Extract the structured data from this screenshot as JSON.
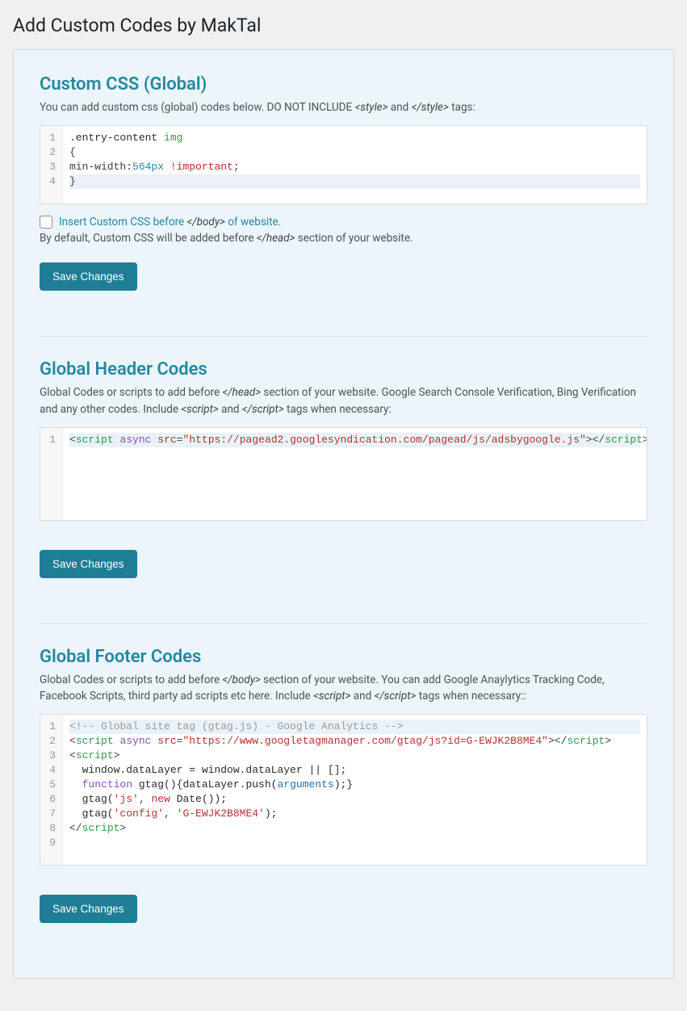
{
  "pageTitle": "Add Custom Codes by MakTal",
  "saveLabel": "Save Changes",
  "css": {
    "title": "Custom CSS (Global)",
    "desc_pre": "You can add custom css (global) codes below. DO NOT INCLUDE ",
    "desc_tag1": "<style>",
    "desc_mid": " and ",
    "desc_tag2": "</style>",
    "desc_post": " tags:",
    "code": [
      [
        {
          "t": ".entry-content ",
          "c": "tok-sel"
        },
        {
          "t": "img",
          "c": "tok-tag"
        }
      ],
      [
        {
          "t": "{",
          "c": ""
        }
      ],
      [
        {
          "t": "min-width:",
          "c": ""
        },
        {
          "t": "564px",
          "c": "tok-num"
        },
        {
          "t": " ",
          "c": ""
        },
        {
          "t": "!important",
          "c": "tok-kw"
        },
        {
          "t": ";",
          "c": ""
        }
      ],
      [
        {
          "t": "}",
          "c": ""
        }
      ]
    ],
    "activeLine": 3,
    "checkbox_pre": "Insert Custom CSS before ",
    "checkbox_tag": "</body>",
    "checkbox_post": " of website.",
    "default_pre": "By default, Custom CSS will be added before ",
    "default_tag": "</head>",
    "default_post": " section of your website."
  },
  "header": {
    "title": "Global Header Codes",
    "desc_pre": "Global Codes or scripts to add before ",
    "desc_tag1": "</head>",
    "desc_mid": " section of your website. Google Search Console Verification, Bing Verification and any other codes. Include ",
    "desc_tag2": "<script>",
    "desc_mid2": " and ",
    "desc_tag3": "</script>",
    "desc_post": " tags when necessary:",
    "code": [
      [
        {
          "t": "<",
          "c": ""
        },
        {
          "t": "script",
          "c": "tok-tag"
        },
        {
          "t": " ",
          "c": ""
        },
        {
          "t": "async",
          "c": "tok-async"
        },
        {
          "t": " ",
          "c": ""
        },
        {
          "t": "src",
          "c": "tok-attr"
        },
        {
          "t": "=",
          "c": ""
        },
        {
          "t": "\"https://pagead2.googlesyndication.com/pagead/js/adsbygoogle.js\"",
          "c": "tok-str"
        },
        {
          "t": ">",
          "c": ""
        },
        {
          "t": "</",
          "c": ""
        },
        {
          "t": "script",
          "c": "tok-tag"
        },
        {
          "t": ">",
          "c": ""
        }
      ]
    ],
    "activeLine": 0,
    "minLines": 5
  },
  "footer": {
    "title": "Global Footer Codes",
    "desc_pre": "Global Codes or scripts to add before ",
    "desc_tag1": "</body>",
    "desc_mid": " section of your website. You can add Google Anaylytics Tracking Code, Facebook Scripts, third party ad scripts etc here. Include ",
    "desc_tag2": "<script>",
    "desc_mid2": " and ",
    "desc_tag3": "</script>",
    "desc_post": " tags when necessary::",
    "code": [
      [
        {
          "t": "<!-- Global site tag (gtag.js) - Google Analytics -->",
          "c": "tok-cmt"
        }
      ],
      [
        {
          "t": "<",
          "c": ""
        },
        {
          "t": "script",
          "c": "tok-tag"
        },
        {
          "t": " ",
          "c": ""
        },
        {
          "t": "async",
          "c": "tok-async"
        },
        {
          "t": " ",
          "c": ""
        },
        {
          "t": "src",
          "c": "tok-attr"
        },
        {
          "t": "=",
          "c": ""
        },
        {
          "t": "\"https://www.googletagmanager.com/gtag/js?id=G-EWJK2B8ME4\"",
          "c": "tok-str"
        },
        {
          "t": ">",
          "c": ""
        },
        {
          "t": "</",
          "c": ""
        },
        {
          "t": "script",
          "c": "tok-tag"
        },
        {
          "t": ">",
          "c": ""
        }
      ],
      [
        {
          "t": "<",
          "c": ""
        },
        {
          "t": "script",
          "c": "tok-tag"
        },
        {
          "t": ">",
          "c": ""
        }
      ],
      [
        {
          "t": "  window.dataLayer = window.dataLayer || [];",
          "c": "tok-fn"
        }
      ],
      [
        {
          "t": "  ",
          "c": ""
        },
        {
          "t": "function",
          "c": "tok-async"
        },
        {
          "t": " gtag(){dataLayer.push(",
          "c": "tok-fn"
        },
        {
          "t": "arguments",
          "c": "tok-arg"
        },
        {
          "t": ");}",
          "c": "tok-fn"
        }
      ],
      [
        {
          "t": "  gtag(",
          "c": "tok-fn"
        },
        {
          "t": "'js'",
          "c": "tok-str"
        },
        {
          "t": ", ",
          "c": ""
        },
        {
          "t": "new",
          "c": "tok-new"
        },
        {
          "t": " Date());",
          "c": "tok-fn"
        }
      ],
      [
        {
          "t": "  gtag(",
          "c": "tok-fn"
        },
        {
          "t": "'config'",
          "c": "tok-str"
        },
        {
          "t": ", ",
          "c": ""
        },
        {
          "t": "'G-EWJK2B8ME4'",
          "c": "tok-str"
        },
        {
          "t": ");",
          "c": "tok-fn"
        }
      ],
      [
        {
          "t": "</",
          "c": ""
        },
        {
          "t": "script",
          "c": "tok-tag"
        },
        {
          "t": ">",
          "c": ""
        }
      ],
      [
        {
          "t": "",
          "c": ""
        }
      ]
    ],
    "activeLine": 0
  }
}
